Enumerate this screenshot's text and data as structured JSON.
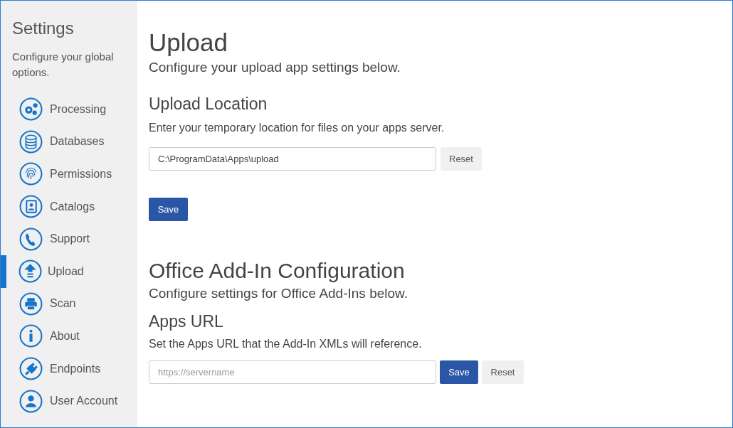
{
  "sidebar": {
    "title": "Settings",
    "description": "Configure your global options.",
    "items": [
      {
        "label": "Processing",
        "selected": false
      },
      {
        "label": "Databases",
        "selected": false
      },
      {
        "label": "Permissions",
        "selected": false
      },
      {
        "label": "Catalogs",
        "selected": false
      },
      {
        "label": "Support",
        "selected": false
      },
      {
        "label": "Upload",
        "selected": true
      },
      {
        "label": "Scan",
        "selected": false
      },
      {
        "label": "About",
        "selected": false
      },
      {
        "label": "Endpoints",
        "selected": false
      },
      {
        "label": "User Account",
        "selected": false
      }
    ]
  },
  "page": {
    "title": "Upload",
    "subtitle": "Configure your upload app settings below."
  },
  "upload_location": {
    "heading": "Upload Location",
    "description": "Enter your temporary location for files on your apps server.",
    "value": "C:\\ProgramData\\Apps\\upload",
    "reset_button": "Reset",
    "save_button": "Save"
  },
  "office_addin": {
    "title": "Office Add-In Configuration",
    "subtitle": "Configure settings for Office Add-Ins below.",
    "heading": "Apps URL",
    "description": "Set the Apps URL that the Add-In XMLs will reference.",
    "placeholder": "https://servername",
    "save_button": "Save",
    "reset_button": "Reset"
  }
}
